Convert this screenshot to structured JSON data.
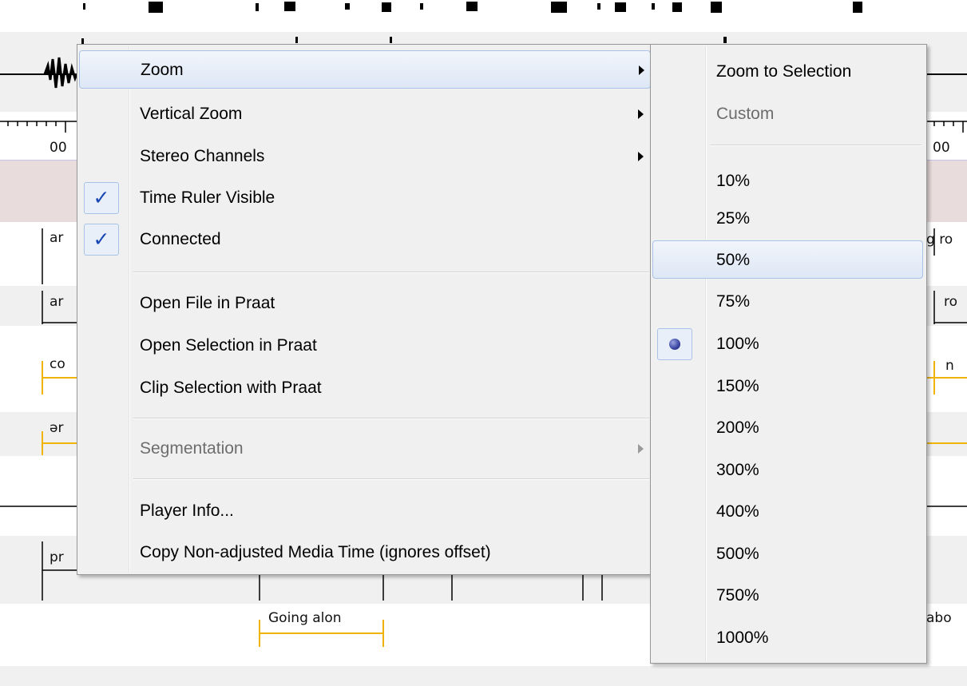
{
  "background": {
    "ruler_labels": [
      "00",
      "00"
    ],
    "tier_fragments": [
      {
        "text": "ar",
        "side": "left"
      },
      {
        "text": "g ro",
        "side": "right"
      },
      {
        "text": "ar",
        "side": "left"
      },
      {
        "text": "ro",
        "side": "right"
      },
      {
        "text": "co",
        "side": "left"
      },
      {
        "text": "n",
        "side": "right"
      },
      {
        "text": "ər",
        "side": "left"
      },
      {
        "text": "pr",
        "side": "left"
      },
      {
        "text": "Going alon",
        "side": "center"
      },
      {
        "text": "abo",
        "side": "right"
      }
    ]
  },
  "context_menu": {
    "items": [
      {
        "label": "Zoom",
        "submenu": true,
        "highlighted": true
      },
      {
        "label": "Vertical Zoom",
        "submenu": true
      },
      {
        "label": "Stereo Channels",
        "submenu": true
      },
      {
        "label": "Time Ruler Visible",
        "checked": true
      },
      {
        "label": "Connected",
        "checked": true
      },
      {
        "label": "Open File in Praat"
      },
      {
        "label": "Open Selection in Praat"
      },
      {
        "label": "Clip Selection with Praat"
      },
      {
        "label": "Segmentation",
        "submenu": true,
        "disabled": true
      },
      {
        "label": "Player Info..."
      },
      {
        "label": "Copy Non-adjusted Media Time (ignores offset)"
      }
    ]
  },
  "zoom_submenu": {
    "items": [
      {
        "label": "Zoom to Selection"
      },
      {
        "label": "Custom",
        "disabled": true
      },
      {
        "label": "10%"
      },
      {
        "label": "25%"
      },
      {
        "label": "50%",
        "highlighted": true
      },
      {
        "label": "75%"
      },
      {
        "label": "100%",
        "selected": true
      },
      {
        "label": "150%"
      },
      {
        "label": "200%"
      },
      {
        "label": "300%"
      },
      {
        "label": "400%"
      },
      {
        "label": "500%"
      },
      {
        "label": "750%"
      },
      {
        "label": "1000%"
      }
    ]
  },
  "colors": {
    "menu_bg": "#f0f0f0",
    "highlight_border": "#a8c3e6",
    "checkmark": "#1846b3",
    "tier_boundary": "#f0b400",
    "selection_band": "#e8dcdc"
  }
}
